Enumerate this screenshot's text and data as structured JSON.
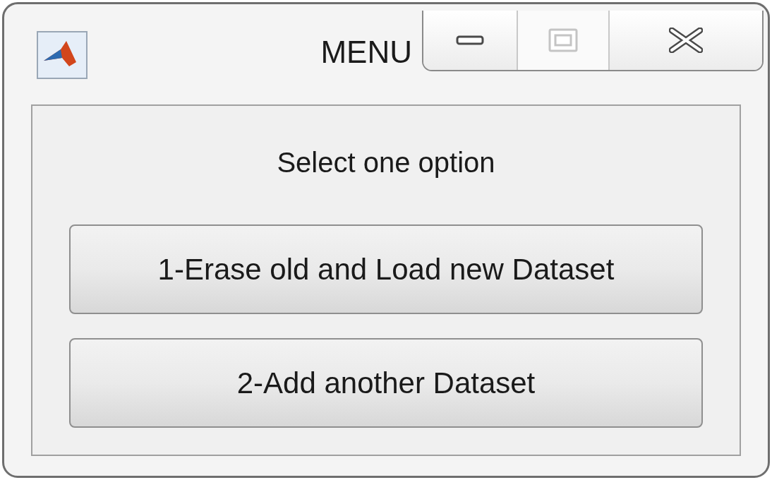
{
  "window": {
    "title": "MENU",
    "controls": [
      {
        "kind": "minimize",
        "disabled": false
      },
      {
        "kind": "maximize",
        "disabled": true
      },
      {
        "kind": "close",
        "disabled": false
      }
    ]
  },
  "prompt": "Select one option",
  "buttons": [
    "1-Erase old and Load new Dataset",
    "2-Add another Dataset"
  ]
}
